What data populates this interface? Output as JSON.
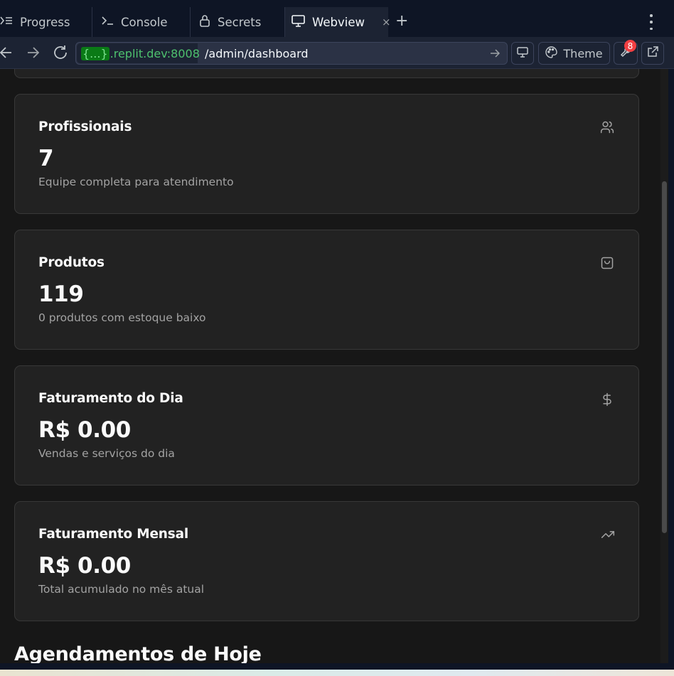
{
  "tabs": [
    {
      "label": "Progress",
      "icon": "progress-icon"
    },
    {
      "label": "Console",
      "icon": "console-icon"
    },
    {
      "label": "Secrets",
      "icon": "lock-icon"
    },
    {
      "label": "Webview",
      "icon": "monitor-icon",
      "close": "×"
    }
  ],
  "address": {
    "host_brace": "{...}",
    "host_rest": ".replit.dev:8008",
    "path": "/admin/dashboard"
  },
  "toolbar": {
    "theme_label": "Theme",
    "devtools_badge": "8"
  },
  "cards": [
    {
      "title": "Profissionais",
      "value": "7",
      "desc": "Equipe completa para atendimento",
      "icon": "users-icon"
    },
    {
      "title": "Produtos",
      "value": "119",
      "desc": "0 produtos com estoque baixo",
      "icon": "shopping-bag-icon"
    },
    {
      "title": "Faturamento do Dia",
      "value": "R$ 0.00",
      "desc": "Vendas e serviços do dia",
      "icon": "dollar-icon"
    },
    {
      "title": "Faturamento Mensal",
      "value": "R$ 0.00",
      "desc": "Total acumulado no mês atual",
      "icon": "trending-up-icon"
    }
  ],
  "section": {
    "title": "Agendamentos de Hoje"
  },
  "colors": {
    "accent_green": "#4ec16e",
    "badge_red": "#f23f42",
    "card_bg": "#222222"
  }
}
